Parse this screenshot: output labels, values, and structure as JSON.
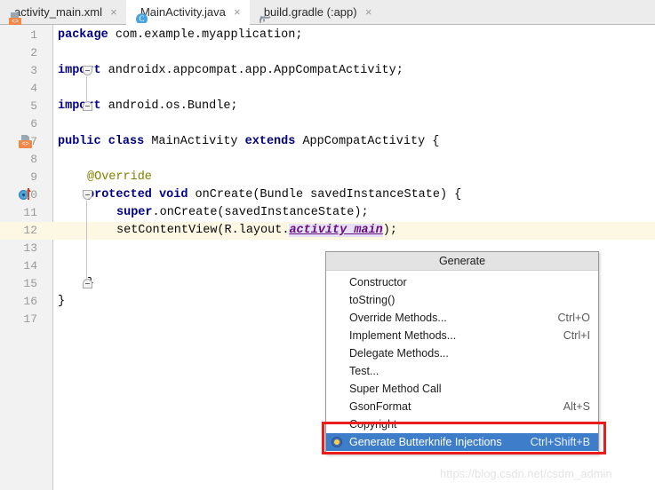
{
  "tabs": [
    {
      "label": "activity_main.xml",
      "icon": "xml-layout-icon",
      "active": false,
      "close": "×"
    },
    {
      "label": "MainActivity.java",
      "icon": "java-class-icon",
      "active": true,
      "close": "×"
    },
    {
      "label": "build.gradle (:app)",
      "icon": "gradle-icon",
      "active": false,
      "close": "×"
    }
  ],
  "editor": {
    "lines": [
      {
        "num": "1",
        "indent": 0,
        "highlight": false,
        "tokens": [
          {
            "t": "package",
            "c": "kw"
          },
          {
            "t": " com.example.myapplication;",
            "c": "id"
          }
        ]
      },
      {
        "num": "2",
        "indent": 0,
        "highlight": false,
        "tokens": []
      },
      {
        "num": "3",
        "indent": 0,
        "highlight": false,
        "tokens": [
          {
            "t": "import",
            "c": "kw"
          },
          {
            "t": " androidx.appcompat.app.AppCompatActivity;",
            "c": "id"
          }
        ]
      },
      {
        "num": "4",
        "indent": 0,
        "highlight": false,
        "tokens": []
      },
      {
        "num": "5",
        "indent": 0,
        "highlight": false,
        "tokens": [
          {
            "t": "import",
            "c": "kw"
          },
          {
            "t": " android.os.Bundle;",
            "c": "id"
          }
        ]
      },
      {
        "num": "6",
        "indent": 0,
        "highlight": false,
        "tokens": []
      },
      {
        "num": "7",
        "indent": 0,
        "highlight": false,
        "tokens": [
          {
            "t": "public class",
            "c": "kw"
          },
          {
            "t": " MainActivity ",
            "c": "id"
          },
          {
            "t": "extends",
            "c": "kw"
          },
          {
            "t": " AppCompatActivity {",
            "c": "id"
          }
        ]
      },
      {
        "num": "8",
        "indent": 0,
        "highlight": false,
        "tokens": []
      },
      {
        "num": "9",
        "indent": 1,
        "highlight": false,
        "tokens": [
          {
            "t": "@Override",
            "c": "ann"
          }
        ]
      },
      {
        "num": "10",
        "indent": 1,
        "highlight": false,
        "tokens": [
          {
            "t": "protected void",
            "c": "kw"
          },
          {
            "t": " onCreate(Bundle savedInstanceState) {",
            "c": "id"
          }
        ]
      },
      {
        "num": "11",
        "indent": 2,
        "highlight": false,
        "tokens": [
          {
            "t": "super",
            "c": "kw"
          },
          {
            "t": ".onCreate(savedInstanceState);",
            "c": "id"
          }
        ]
      },
      {
        "num": "12",
        "indent": 2,
        "highlight": true,
        "tokens": [
          {
            "t": "setContentView(R.layout.",
            "c": "id"
          },
          {
            "t": "activity_main",
            "c": "hlid"
          },
          {
            "t": ");",
            "c": "id"
          }
        ]
      },
      {
        "num": "13",
        "indent": 0,
        "highlight": false,
        "tokens": []
      },
      {
        "num": "14",
        "indent": 0,
        "highlight": false,
        "tokens": []
      },
      {
        "num": "15",
        "indent": 1,
        "highlight": false,
        "tokens": [
          {
            "t": "}",
            "c": "id"
          }
        ]
      },
      {
        "num": "16",
        "indent": 0,
        "highlight": false,
        "tokens": [
          {
            "t": "}",
            "c": "id"
          }
        ]
      },
      {
        "num": "17",
        "indent": 0,
        "highlight": false,
        "tokens": []
      }
    ],
    "gutter_markers": [
      {
        "line": "7",
        "icon": "class-structure-icon"
      },
      {
        "line": "10",
        "icon": "override-method-icon"
      }
    ],
    "highlight_color": "#fdf8e3",
    "selected_identifier_color": "#e6e0f8"
  },
  "popup": {
    "title": "Generate",
    "items": [
      {
        "label": "Constructor",
        "shortcut": "",
        "selected": false,
        "icon": ""
      },
      {
        "label": "toString()",
        "shortcut": "",
        "selected": false,
        "icon": ""
      },
      {
        "label": "Override Methods...",
        "shortcut": "Ctrl+O",
        "selected": false,
        "icon": ""
      },
      {
        "label": "Implement Methods...",
        "shortcut": "Ctrl+I",
        "selected": false,
        "icon": ""
      },
      {
        "label": "Delegate Methods...",
        "shortcut": "",
        "selected": false,
        "icon": ""
      },
      {
        "label": "Test...",
        "shortcut": "",
        "selected": false,
        "icon": ""
      },
      {
        "label": "Super Method Call",
        "shortcut": "",
        "selected": false,
        "icon": ""
      },
      {
        "label": "GsonFormat",
        "shortcut": "Alt+S",
        "selected": false,
        "icon": ""
      },
      {
        "label": "Copyright",
        "shortcut": "",
        "selected": false,
        "icon": ""
      },
      {
        "label": "Generate Butterknife Injections",
        "shortcut": "Ctrl+Shift+B",
        "selected": true,
        "icon": "butterknife-bullet-icon"
      }
    ],
    "selection_color": "#3e7dc9",
    "header_color": "#e3e3e3"
  },
  "annotation": {
    "highlight_box_color": "#ec1c1c"
  },
  "watermark": {
    "text": "https://blog.csdn.net/csdm_admin"
  }
}
